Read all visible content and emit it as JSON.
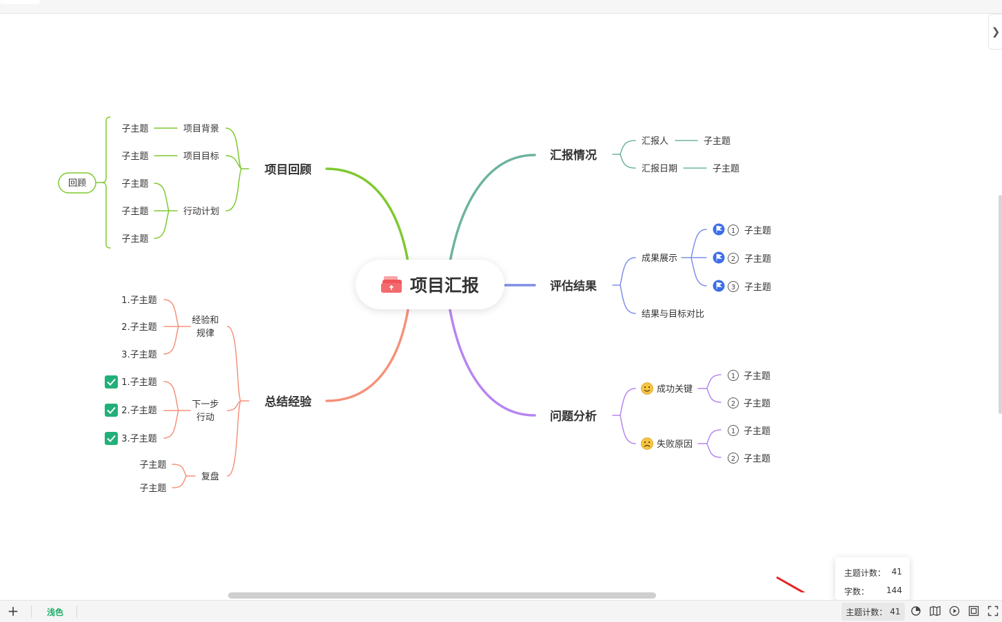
{
  "center": {
    "title": "项目汇报"
  },
  "branches": {
    "review": {
      "title": "项目回顾",
      "children": [
        "项目背景",
        "项目目标",
        "行动计划"
      ],
      "sub": [
        "子主题",
        "子主题",
        "子主题",
        "子主题",
        "子主题"
      ],
      "summary": "回顾"
    },
    "summary": {
      "title": "总结经验",
      "children": [
        "经验和",
        "规律",
        "下一步",
        "行动",
        "复盘"
      ],
      "lessons": [
        "1.子主题",
        "2.子主题",
        "3.子主题"
      ],
      "actions": [
        "1.子主题",
        "2.子主题",
        "3.子主题"
      ],
      "replay": [
        "子主题",
        "子主题"
      ]
    },
    "report": {
      "title": "汇报情况",
      "children": [
        "汇报人",
        "汇报日期"
      ],
      "sub": [
        "子主题",
        "子主题"
      ]
    },
    "evaluation": {
      "title": "评估结果",
      "children": [
        "成果展示",
        "结果与目标对比"
      ],
      "sub": [
        "子主题",
        "子主题",
        "子主题"
      ],
      "nums": [
        "1",
        "2",
        "3"
      ]
    },
    "problems": {
      "title": "问题分析",
      "children": [
        "成功关键",
        "失败原因"
      ],
      "sub": [
        "子主题",
        "子主题",
        "子主题",
        "子主题"
      ],
      "nums": [
        "1",
        "2",
        "1",
        "2"
      ]
    }
  },
  "colors": {
    "green": "#7ec92f",
    "salmon": "#f5917a",
    "teal": "#6db3a0",
    "blue": "#7f8ee8",
    "purple": "#b784f0",
    "flag": "#3d6ee8",
    "check": "#21b07a"
  },
  "bottombar": {
    "theme": "浅色",
    "topic_count_label": "主题计数：",
    "topic_count": "41"
  },
  "tooltip": {
    "topic_label": "主题计数：",
    "topic_value": "41",
    "words_label": "字数：",
    "words_value": "144"
  }
}
